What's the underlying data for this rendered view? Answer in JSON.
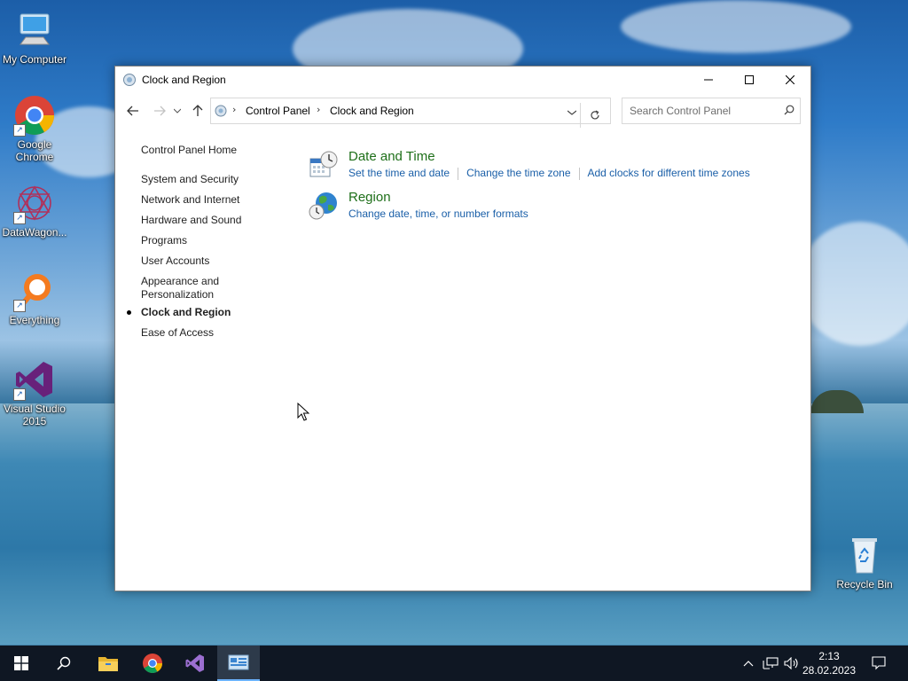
{
  "desktop": {
    "icons": [
      {
        "label": "My Computer",
        "icon": "computer-icon"
      },
      {
        "label": "Google Chrome",
        "icon": "chrome-icon"
      },
      {
        "label": "DataWagon...",
        "icon": "datawagon-icon"
      },
      {
        "label": "Everything",
        "icon": "search-magnifier-icon"
      },
      {
        "label": "Visual Studio 2015",
        "icon": "visual-studio-icon"
      },
      {
        "label": "Recycle Bin",
        "icon": "recycle-bin-icon"
      }
    ]
  },
  "window": {
    "title": "Clock and Region",
    "address": {
      "crumbs": [
        "Control Panel",
        "Clock and Region"
      ]
    },
    "search": {
      "placeholder": "Search Control Panel"
    },
    "leftnav": {
      "home": "Control Panel Home",
      "items": [
        "System and Security",
        "Network and Internet",
        "Hardware and Sound",
        "Programs",
        "User Accounts",
        "Appearance and Personalization",
        "Clock and Region",
        "Ease of Access"
      ],
      "current_index": 6
    },
    "categories": [
      {
        "title": "Date and Time",
        "icon": "date-time-icon",
        "links": [
          "Set the time and date",
          "Change the time zone",
          "Add clocks for different time zones"
        ]
      },
      {
        "title": "Region",
        "icon": "region-globe-icon",
        "links": [
          "Change date, time, or number formats"
        ]
      }
    ]
  },
  "taskbar": {
    "time": "2:13",
    "date": "28.02.2023",
    "accent": "#6cb4ff"
  }
}
